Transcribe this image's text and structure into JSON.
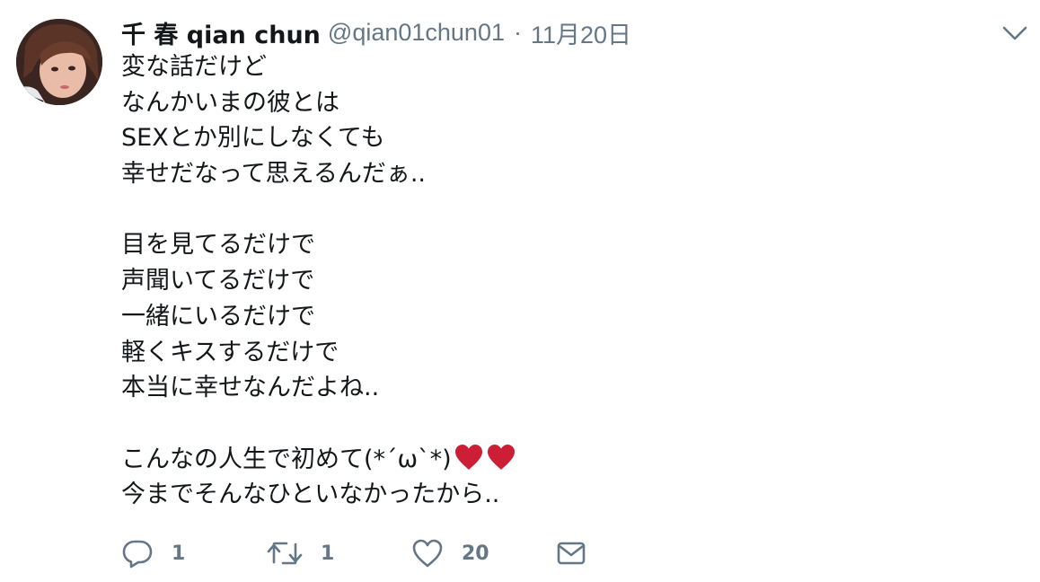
{
  "tweet": {
    "display_name": "千 春 qian chun",
    "handle": "@qian01chun01",
    "separator": "·",
    "date": "11月20日",
    "body_lines": [
      "変な話だけど",
      "なんかいまの彼とは",
      "SEXとか別にしなくても",
      "幸せだなって思えるんだぁ..",
      "",
      "目を見てるだけで",
      "声聞いてるだけで",
      "一緒にいるだけで",
      "軽くキスするだけで",
      "本当に幸せなんだよね..",
      "",
      "こんなの人生で初めて(*´ω`*)",
      "今までそんなひといなかったから.."
    ],
    "emoji": [
      "heart-emoji",
      "heart-emoji"
    ],
    "actions": {
      "reply_count": "1",
      "retweet_count": "1",
      "like_count": "20"
    }
  },
  "colors": {
    "text": "#14171a",
    "secondary": "#657786",
    "heart_emoji": "#cc1f36"
  },
  "icons": {
    "more": "chevron-down-icon",
    "reply": "reply-icon",
    "retweet": "retweet-icon",
    "like": "heart-icon",
    "message": "envelope-icon"
  }
}
